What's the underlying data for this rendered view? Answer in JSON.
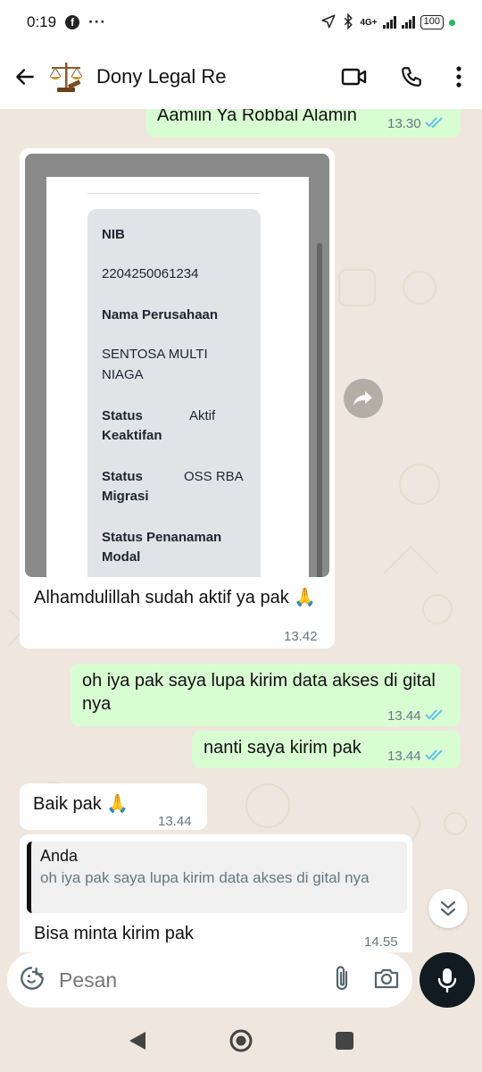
{
  "status": {
    "time": "0:19",
    "facebook_glyph": "f",
    "more": "···",
    "network": "4G+",
    "battery": "100"
  },
  "header": {
    "title": "Dony Legal Re",
    "back_icon": "arrow-left-icon",
    "video_icon": "video-camera-icon",
    "call_icon": "phone-icon",
    "menu_icon": "more-vert-icon"
  },
  "messages": [
    {
      "dir": "out",
      "text": "Aamiin Ya Robbal Alamin",
      "time": "13.30"
    },
    {
      "dir": "in",
      "image": true,
      "text": "Alhamdulillah sudah aktif ya pak 🙏",
      "time": "13.42"
    },
    {
      "dir": "out",
      "text": "oh iya pak saya lupa kirim data akses di gital nya",
      "time": "13.44"
    },
    {
      "dir": "out",
      "text": "nanti saya kirim pak",
      "time": "13.44"
    },
    {
      "dir": "in",
      "text": "Baik pak 🙏",
      "time": "13.44"
    },
    {
      "dir": "in",
      "reply_to": {
        "author": "Anda",
        "text": "oh iya pak saya lupa kirim data akses di gital nya"
      },
      "text": "Bisa minta kirim pak",
      "time": "14.55"
    }
  ],
  "card": {
    "nib_label": "NIB",
    "nib_value": "2204250061234",
    "company_label": "Nama Perusahaan",
    "company_value_1": "SENTOSA MULTI",
    "company_value_2": "NIAGA",
    "status_active_label_1": "Status",
    "status_active_label_2": "Keaktifan",
    "status_active_value": "Aktif",
    "status_migration_label_1": "Status",
    "status_migration_label_2": "Migrasi",
    "status_migration_value": "OSS RBA",
    "investment_label_1": "Status Penanaman",
    "investment_label_2": "Modal"
  },
  "input": {
    "placeholder": "Pesan"
  },
  "colors": {
    "outgoing": "#d9fdd3",
    "incoming": "#ffffff",
    "tick": "#53bdeb",
    "chat_bg": "#efe7dd"
  }
}
